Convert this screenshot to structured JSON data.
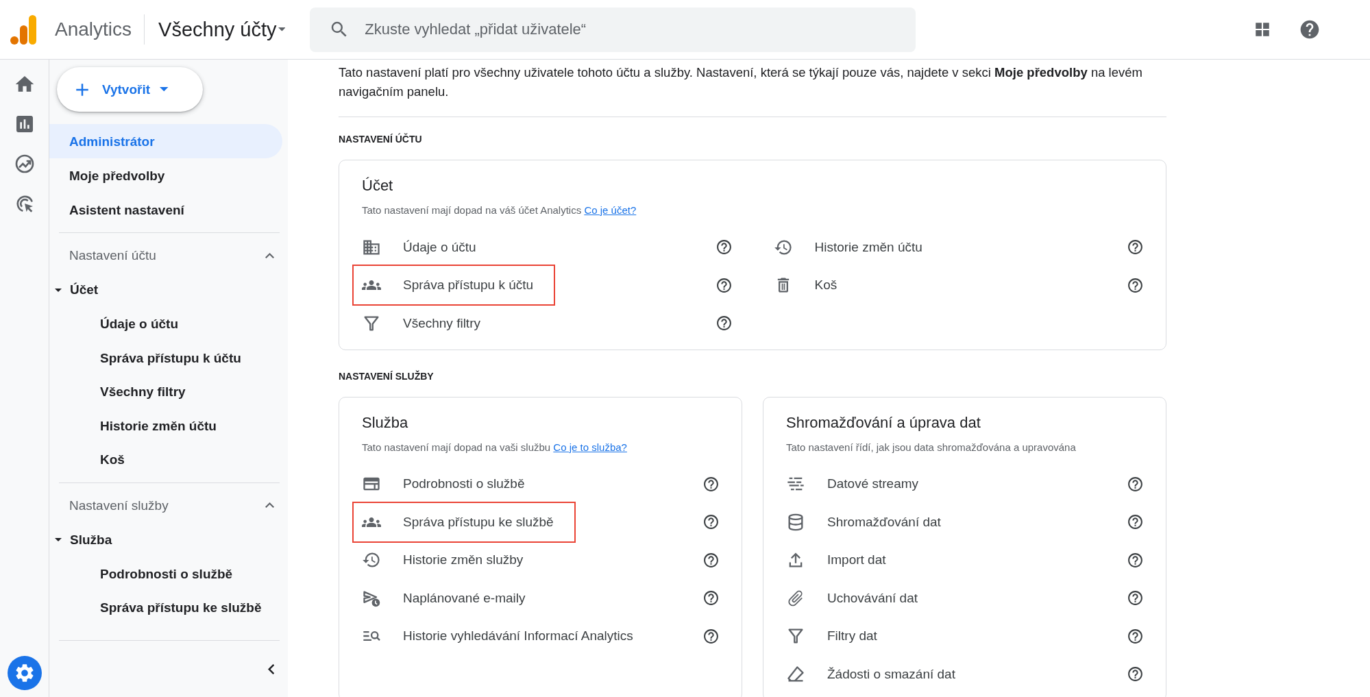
{
  "app": {
    "name": "Analytics",
    "account": "Všechny účty"
  },
  "search": {
    "placeholder": "Zkuste vyhledat „přidat uživatele“"
  },
  "create_button": "Vytvořit",
  "sidebar": {
    "items": [
      {
        "label": "Administrátor",
        "selected": true
      },
      {
        "label": "Moje předvolby",
        "selected": false
      },
      {
        "label": "Asistent nastavení",
        "selected": false
      }
    ],
    "sections": [
      {
        "title": "Nastavení účtu",
        "expanded": true,
        "children": [
          {
            "label": "Účet",
            "expanded": true,
            "children": [
              {
                "label": "Údaje o účtu"
              },
              {
                "label": "Správa přístupu k účtu"
              },
              {
                "label": "Všechny filtry"
              },
              {
                "label": "Historie změn účtu"
              },
              {
                "label": "Koš"
              }
            ]
          }
        ]
      },
      {
        "title": "Nastavení služby",
        "expanded": true,
        "children": [
          {
            "label": "Služba",
            "expanded": true,
            "children": [
              {
                "label": "Podrobnosti o službě"
              },
              {
                "label": "Správa přístupu ke službě"
              }
            ]
          }
        ]
      }
    ]
  },
  "intro": "Tato nastavení platí pro všechny uživatele tohoto účtu a služby. Nastavení, která se týkají pouze vás, najdete v sekci **Moje předvolby** na levém navigačním panelu.",
  "groups": [
    {
      "heading": "NASTAVENÍ ÚČTU",
      "cards": [
        {
          "title": "Účet",
          "description": "Tato nastavení mají dopad na váš účet Analytics",
          "link": "Co je účet?",
          "columns": [
            [
              {
                "kind": "building",
                "label": "Údaje o účtu",
                "highlighted": false
              },
              {
                "kind": "people",
                "label": "Správa přístupu k účtu",
                "highlighted": true
              },
              {
                "kind": "filter",
                "label": "Všechny filtry",
                "highlighted": false
              }
            ],
            [
              {
                "kind": "history",
                "label": "Historie změn účtu",
                "highlighted": false
              },
              {
                "kind": "trash",
                "label": "Koš",
                "highlighted": false
              }
            ]
          ]
        }
      ]
    },
    {
      "heading": "NASTAVENÍ SLUŽBY",
      "cards": [
        {
          "title": "Služba",
          "description": "Tato nastavení mají dopad na vaši službu",
          "link": "Co je to služba?",
          "columns": [
            [
              {
                "kind": "panel",
                "label": "Podrobnosti o službě",
                "highlighted": false
              },
              {
                "kind": "people",
                "label": "Správa přístupu ke službě",
                "highlighted": true
              },
              {
                "kind": "history",
                "label": "Historie změn služby",
                "highlighted": false
              },
              {
                "kind": "send-clock",
                "label": "Naplánované e-maily",
                "highlighted": false
              },
              {
                "kind": "search-list",
                "label": "Historie vyhledávání Informací Analytics",
                "highlighted": false
              }
            ]
          ]
        },
        {
          "title": "Shromažďování a úprava dat",
          "description": "Tato nastavení řídí, jak jsou data shromažďována a upravována",
          "columns": [
            [
              {
                "kind": "streams",
                "label": "Datové streamy",
                "highlighted": false
              },
              {
                "kind": "database",
                "label": "Shromažďování dat",
                "highlighted": false
              },
              {
                "kind": "upload",
                "label": "Import dat",
                "highlighted": false
              },
              {
                "kind": "clip",
                "label": "Uchovávání dat",
                "highlighted": false
              },
              {
                "kind": "filter",
                "label": "Filtry dat",
                "highlighted": false
              },
              {
                "kind": "eraser",
                "label": "Žádosti o smazání dat",
                "highlighted": false
              }
            ]
          ]
        }
      ]
    }
  ]
}
